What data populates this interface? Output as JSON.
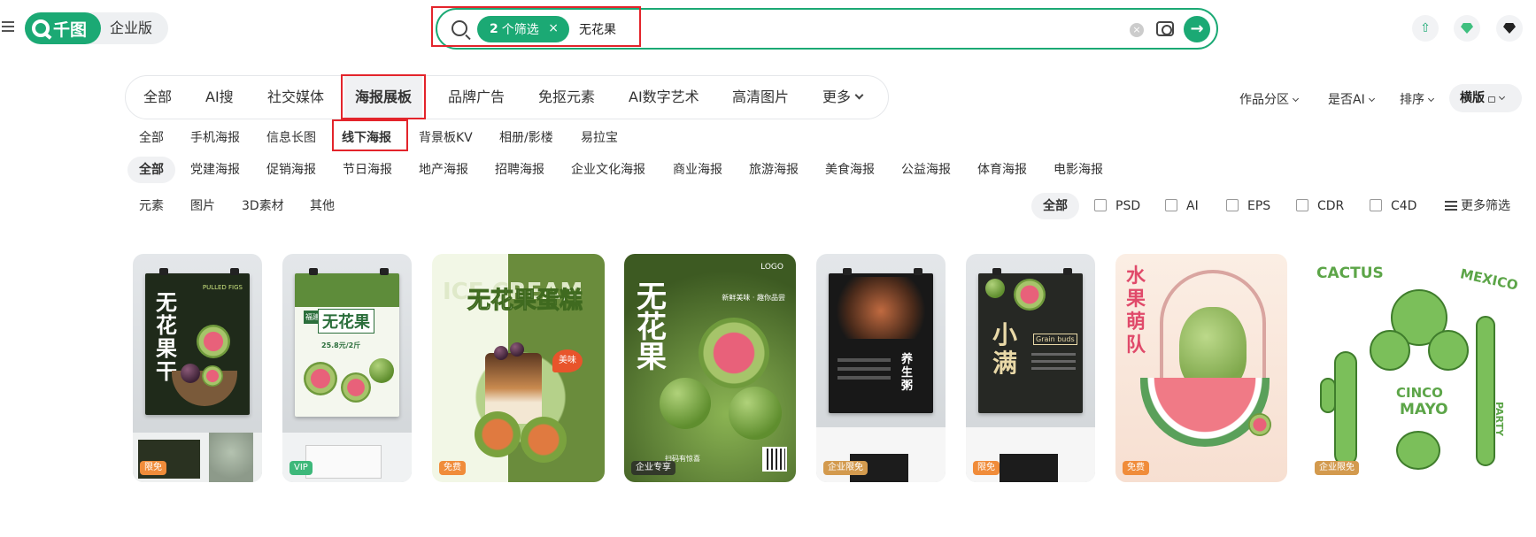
{
  "header": {
    "logo_text": "千图",
    "edition": "企业版",
    "search": {
      "filter_chip_count": "2",
      "filter_chip_label": "个筛选",
      "filter_chip_close": "×",
      "query": "无花果",
      "clear": "×",
      "go": "→"
    }
  },
  "categories": [
    {
      "label": "全部"
    },
    {
      "label": "AI搜"
    },
    {
      "label": "社交媒体"
    },
    {
      "label": "海报展板",
      "active": true
    },
    {
      "label": "品牌广告"
    },
    {
      "label": "免抠元素"
    },
    {
      "label": "AI数字艺术"
    },
    {
      "label": "高清图片"
    },
    {
      "label": "更多"
    }
  ],
  "sort_bar": {
    "zone": "作品分区",
    "ai": "是否AI",
    "order": "排序",
    "orientation": "横版"
  },
  "sub_categories": [
    "全部",
    "手机海报",
    "信息长图",
    "线下海报",
    "背景板KV",
    "相册/影楼",
    "易拉宝"
  ],
  "themes": [
    "全部",
    "党建海报",
    "促销海报",
    "节日海报",
    "地产海报",
    "招聘海报",
    "企业文化海报",
    "商业海报",
    "旅游海报",
    "美食海报",
    "公益海报",
    "体育海报",
    "电影海报"
  ],
  "asset_types": [
    "元素",
    "图片",
    "3D素材",
    "其他"
  ],
  "formats": {
    "all": "全部",
    "items": [
      "PSD",
      "AI",
      "EPS",
      "CDR",
      "C4D"
    ],
    "more": "更多筛选"
  },
  "cards": [
    {
      "badge": "限免",
      "title": "无花果干",
      "subtitle": "PULLED FIGS"
    },
    {
      "badge": "VIP",
      "title": "无花果",
      "tag": "福建",
      "price": "25.8元/2斤"
    },
    {
      "badge": "免费",
      "title": "无花果蛋糕",
      "bg_word": "ICE CREAM",
      "sticker": "美味"
    },
    {
      "badge": "企业专享",
      "title": "无花果",
      "logo": "LOGO",
      "tagline": "新鲜美味 · 趣你品尝",
      "qr_text": "扫码有惊喜"
    },
    {
      "badge": "企业限免",
      "title": "养生粥"
    },
    {
      "badge": "限免",
      "title": "小满",
      "subtitle": "Grain buds"
    },
    {
      "badge": "免费",
      "title": "水果萌队"
    },
    {
      "badge": "企业限免",
      "words": [
        "CACTUS",
        "MEXICO",
        "CINCO",
        "MAYO",
        "PARTY"
      ]
    }
  ],
  "colors": {
    "brand": "#1ba974",
    "highlight_box": "#e3242b"
  }
}
